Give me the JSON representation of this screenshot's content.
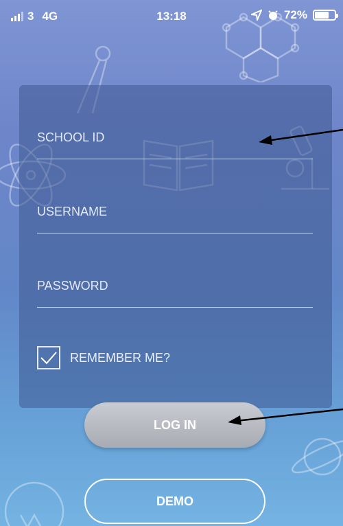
{
  "status_bar": {
    "carrier": "3",
    "network": "4G",
    "time": "13:18",
    "battery": "72%",
    "battery_level": 0.72
  },
  "form": {
    "school_id_placeholder": "SCHOOL ID",
    "username_placeholder": "USERNAME",
    "password_placeholder": "PASSWORD",
    "remember_label": "REMEMBER ME?",
    "remember_checked": true
  },
  "buttons": {
    "login_label": "LOG IN",
    "demo_label": "DEMO"
  },
  "colors": {
    "panel": "#405a92",
    "login_button": "#b8bcc3",
    "arrow": "#000000"
  },
  "icons": [
    "signal-icon",
    "location-icon",
    "alarm-icon",
    "battery-icon",
    "check-icon"
  ]
}
